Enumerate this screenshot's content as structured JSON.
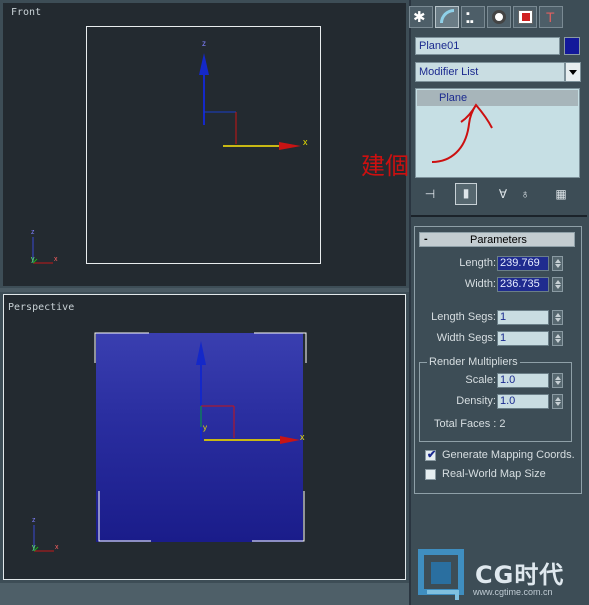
{
  "viewports": {
    "front": {
      "label": "Front"
    },
    "perspective": {
      "label": "Perspective"
    }
  },
  "command_panel": {
    "tabs": [
      "create-icon",
      "modify-icon",
      "hierarchy-icon",
      "motion-icon",
      "display-icon",
      "utilities-icon"
    ],
    "object_name": "Plane01",
    "object_color": "#12189a",
    "modifier_list": "Modifier List",
    "stack_item": "Plane",
    "annotation": "建個"
  },
  "parameters": {
    "title": "Parameters",
    "collapse": "-",
    "length_label": "Length:",
    "length_value": "239.769",
    "width_label": "Width:",
    "width_value": "236.735",
    "length_segs_label": "Length Segs:",
    "length_segs_value": "1",
    "width_segs_label": "Width Segs:",
    "width_segs_value": "1",
    "render_group": "Render Multipliers",
    "scale_label": "Scale:",
    "scale_value": "1.0",
    "density_label": "Density:",
    "density_value": "1.0",
    "total_faces": "Total Faces : 2",
    "generate_mapping": "Generate Mapping Coords.",
    "generate_mapping_checked": true,
    "real_world": "Real-World Map Size",
    "real_world_checked": false
  },
  "axes": {
    "x": "x",
    "y": "y",
    "z": "z"
  },
  "watermark": {
    "brand": "CG时代",
    "url": "www.cgtime.com.cn"
  }
}
